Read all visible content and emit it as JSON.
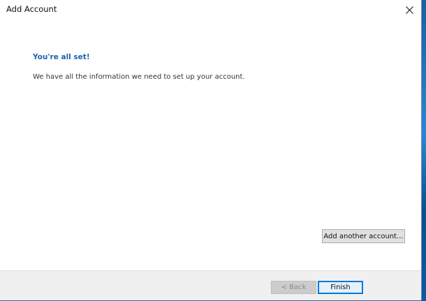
{
  "window": {
    "title": "Add Account"
  },
  "content": {
    "heading": "You're all set!",
    "message": "We have all the information we need to set up your account."
  },
  "buttons": {
    "add_another": "Add another account...",
    "back": "< Back",
    "finish": "Finish"
  },
  "icons": {
    "close": "close-icon"
  },
  "colors": {
    "heading": "#1c64ad",
    "focus_border": "#0078d7",
    "desktop": "#1f6fb5"
  }
}
